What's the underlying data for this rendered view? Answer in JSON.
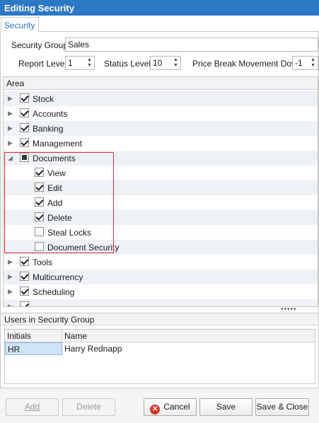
{
  "window": {
    "title": "Editing Security"
  },
  "tabs": [
    {
      "label": "Security"
    }
  ],
  "form": {
    "security_group_label": "Security Group",
    "security_group_value": "Sales",
    "report_level_label": "Report Level",
    "report_level_value": "1",
    "status_level_label": "Status Level",
    "status_level_value": "10",
    "price_break_label": "Price Break Movement Down",
    "price_break_value": "-1"
  },
  "area_grid": {
    "header": "Area",
    "rows": [
      {
        "label": "Stock",
        "checked": true
      },
      {
        "label": "Accounts",
        "checked": true
      },
      {
        "label": "Banking",
        "checked": true
      },
      {
        "label": "Management",
        "checked": true
      },
      {
        "label": "Documents",
        "checked": "partial",
        "expanded": true
      },
      {
        "label": "View",
        "checked": true,
        "child": true
      },
      {
        "label": "Edit",
        "checked": true,
        "child": true
      },
      {
        "label": "Add",
        "checked": true,
        "child": true
      },
      {
        "label": "Delete",
        "checked": true,
        "child": true
      },
      {
        "label": "Steal Locks",
        "checked": false,
        "child": true
      },
      {
        "label": "Document Security",
        "checked": false,
        "child": true
      },
      {
        "label": "Tools",
        "checked": true
      },
      {
        "label": "Multicurrency",
        "checked": true
      },
      {
        "label": "Scheduling",
        "checked": true
      }
    ]
  },
  "users": {
    "section_label": "Users in Security Group",
    "columns": [
      "Initials",
      "Name"
    ],
    "rows": [
      {
        "initials": "HR",
        "name": "Harry Rednapp"
      }
    ]
  },
  "buttons": {
    "add": "Add",
    "delete": "Delete",
    "cancel": "Cancel",
    "save": "Save",
    "save_close": "Save & Close"
  },
  "colors": {
    "title_bar": "#2b78c4",
    "highlight_box": "#d9302f",
    "cancel_icon": "#d23a2a"
  }
}
